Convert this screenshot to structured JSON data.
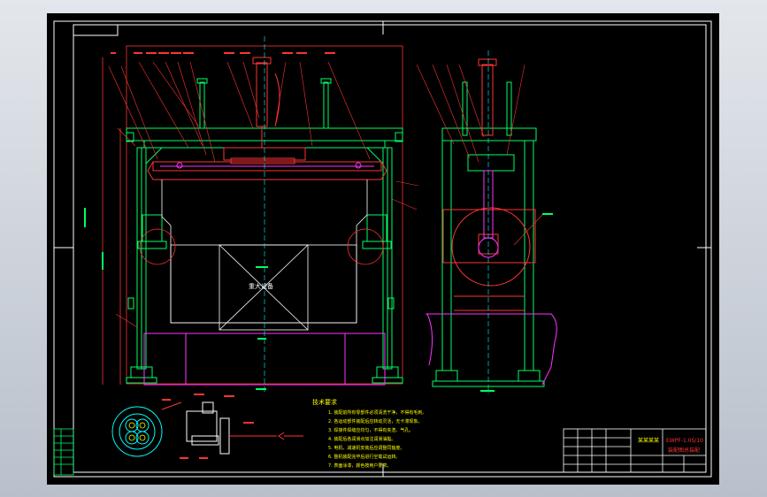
{
  "drawing": {
    "center_label": "重大设备",
    "title_block": {
      "company": "某某某某",
      "drawing_no": "EWPF-1.0S/10",
      "drawing_name": "装配图总装配"
    },
    "tech_requirements": {
      "heading": "技术要求",
      "items": [
        "1. 装配前所有零部件必须清洗干净，不得有毛刺。",
        "2. 各运动部件装配后应转动灵活，无卡滞现象。",
        "3. 焊接件焊缝应均匀，不得有夹渣、气孔。",
        "4. 装配后各润滑点加注润滑油脂。",
        "5. 电机、减速机安装后应调整同轴度。",
        "6. 整机装配完毕后进行空载试运转。",
        "7. 表面涂漆，颜色按用户要求。"
      ]
    }
  },
  "colors": {
    "background": "#000000",
    "frame": "#ffffff",
    "outline": "#ff3333",
    "structure": "#00ff66",
    "accent_magenta": "#ff33ff",
    "accent_cyan": "#00ffff",
    "accent_yellow": "#ffff00"
  }
}
